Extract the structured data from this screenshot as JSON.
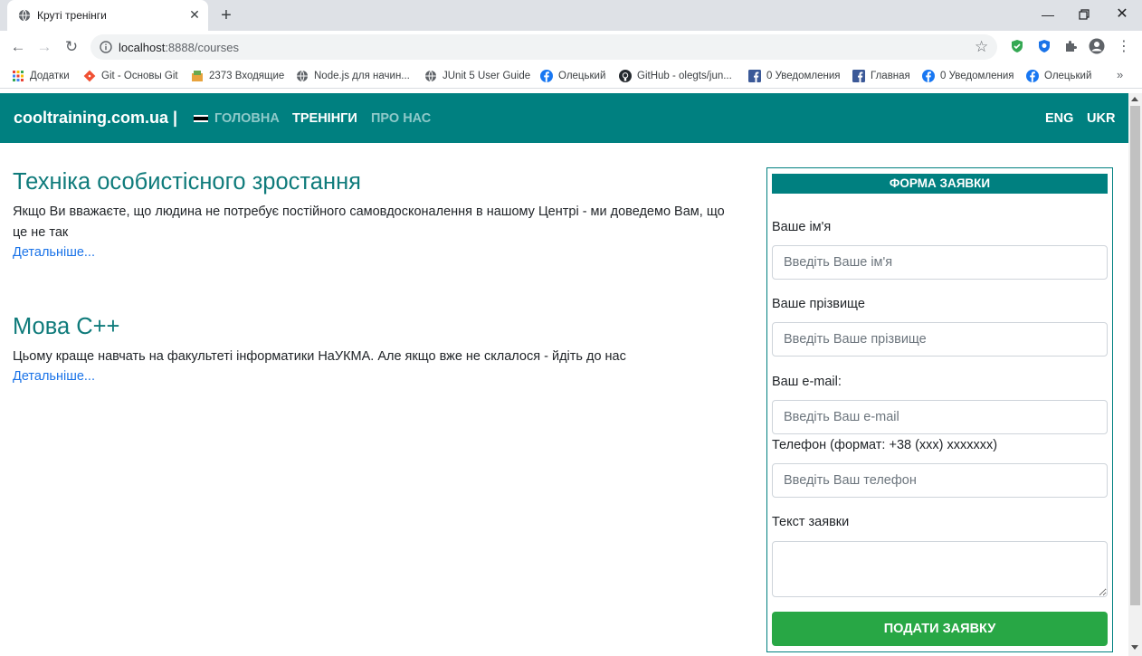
{
  "browser": {
    "tab_title": "Круті тренінги",
    "url_host": "localhost",
    "url_path": ":8888/courses",
    "bookmarks": [
      {
        "label": "Додатки",
        "icon": "apps-grid-icon"
      },
      {
        "label": "Git - Основы Git",
        "icon": "git-icon"
      },
      {
        "label": "2373 Входящие",
        "icon": "mail-icon"
      },
      {
        "label": "Node.js для начин...",
        "icon": "globe-icon"
      },
      {
        "label": "JUnit 5 User Guide",
        "icon": "globe-icon"
      },
      {
        "label": "Олецький",
        "icon": "facebook-icon"
      },
      {
        "label": "GitHub - olegts/jun...",
        "icon": "github-icon"
      },
      {
        "label": "0 Уведомления",
        "icon": "facebook-square-icon"
      },
      {
        "label": "Главная",
        "icon": "facebook-square-icon"
      },
      {
        "label": "0 Уведомления",
        "icon": "facebook-icon"
      },
      {
        "label": "Олецький",
        "icon": "facebook-icon"
      }
    ],
    "more_label": "»"
  },
  "navbar": {
    "brand": "cooltraining.com.ua |",
    "links": [
      "ГОЛОВНА",
      "ТРЕНІНГИ",
      "ПРО НАС"
    ],
    "langs": [
      "ENG",
      "UKR"
    ]
  },
  "courses": [
    {
      "title": "Техніка особистісного зростання",
      "description": "Якщо Ви вважаєте, що людина не потребує постійного самовдосконалення в нашому Центрі - ми доведемо Вам, що це не так",
      "link": "Детальніше..."
    },
    {
      "title": "Мова С++",
      "description": "Цьому краще навчать на факультеті інформатики НаУКМА. Але якщо вже не склалося - йдіть до нас",
      "link": "Детальніше..."
    }
  ],
  "form": {
    "header": "ФОРМА ЗАЯВКИ",
    "name_label": "Ваше ім'я",
    "name_placeholder": "Введіть Ваше ім'я",
    "surname_label": "Ваше прізвище",
    "surname_placeholder": "Введіть Ваше прізвище",
    "email_label": "Ваш e-mail:",
    "email_placeholder": "Введіть Ваш e-mail",
    "phone_label": "Телефон (формат: +38 (xxx) xxxxxxx)",
    "phone_placeholder": "Введіть Ваш телефон",
    "message_label": "Текст заявки",
    "submit_label": "ПОДАТИ ЗАЯВКУ"
  },
  "colors": {
    "brand": "#008080",
    "submit": "#28a745",
    "link": "#1a73e8"
  }
}
